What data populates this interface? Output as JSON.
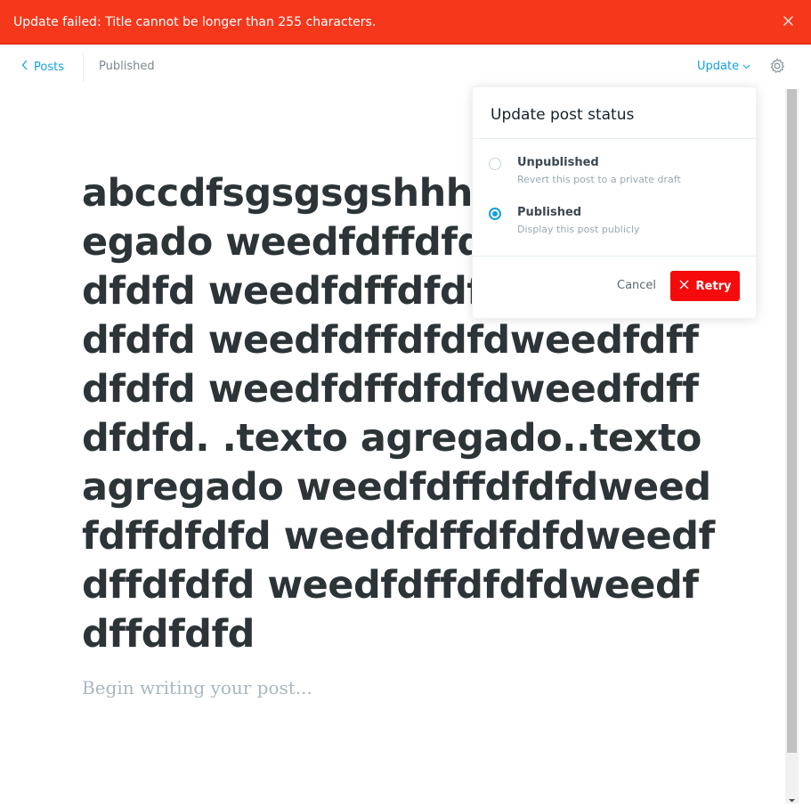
{
  "alert": {
    "message": "Update failed: Title cannot be longer than 255 characters.",
    "close_icon": "close-icon",
    "color": "#f5371b"
  },
  "topbar": {
    "back_label": "Posts",
    "status": "Published",
    "update_label": "Update",
    "settings_icon": "gear-icon"
  },
  "editor": {
    "title": "abccdfsgsgsgshhh...texto agregado weedfdffdfdfdweedfdffdfdfd weedfdffdfdfdweedfdffdfdfd weedfdffdfdfdweedfdffdfdfd weedfdffdfdfdweedfdffdfdfd. .texto agregado..texto agregado weedfdffdfdfdweedfdffdfdfd weedfdffdfdfdweedfdffdfdfd weedfdffdfdfdweedfdffdfdfd",
    "body_placeholder": "Begin writing your post..."
  },
  "popup": {
    "title": "Update post status",
    "options": [
      {
        "label": "Unpublished",
        "description": "Revert this post to a private draft",
        "selected": false
      },
      {
        "label": "Published",
        "description": "Display this post publicly",
        "selected": true
      }
    ],
    "cancel_label": "Cancel",
    "retry_label": "Retry",
    "accent_color": "#14a0dc",
    "danger_color": "#f50b0b"
  }
}
